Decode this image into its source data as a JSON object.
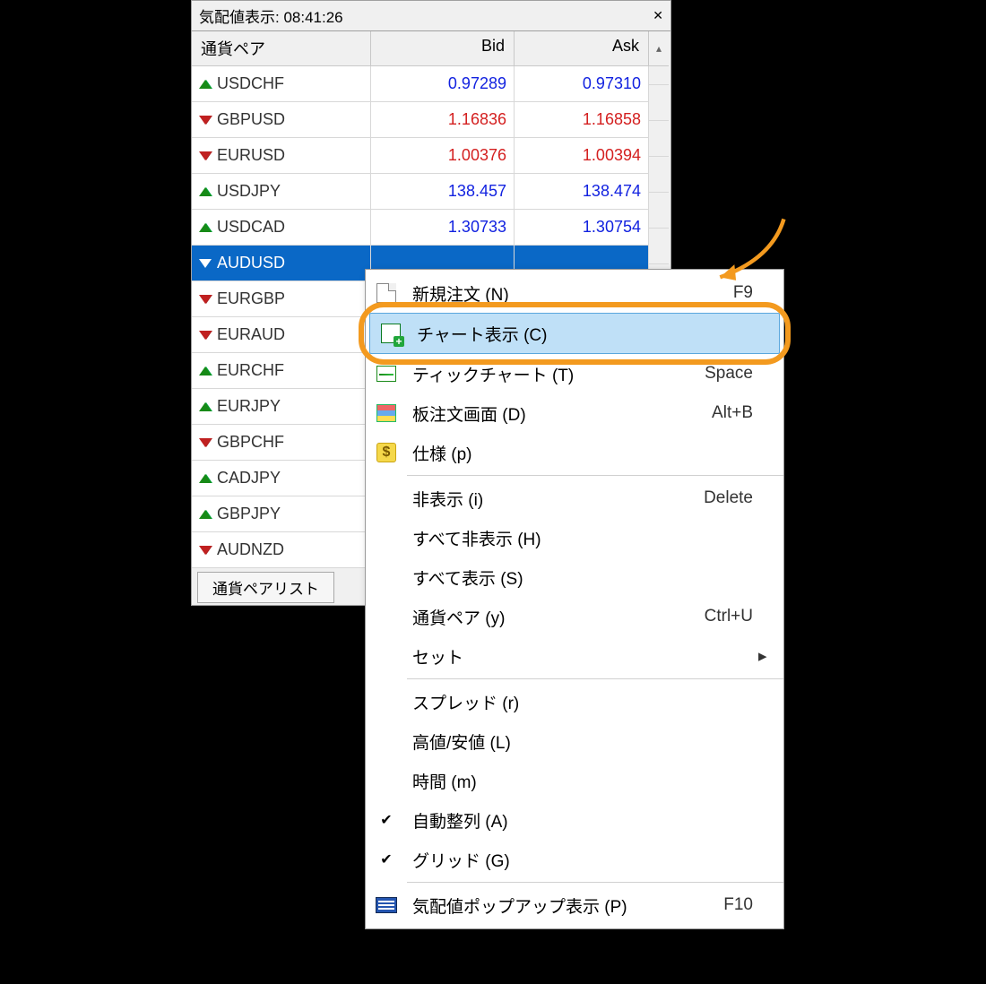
{
  "panel": {
    "title": "気配値表示: 08:41:26",
    "columns": {
      "symbol": "通貨ペア",
      "bid": "Bid",
      "ask": "Ask"
    },
    "tab": "通貨ペアリスト"
  },
  "rows": [
    {
      "dir": "up",
      "symbol": "USDCHF",
      "bid": "0.97289",
      "ask": "0.97310",
      "color": "blue"
    },
    {
      "dir": "down",
      "symbol": "GBPUSD",
      "bid": "1.16836",
      "ask": "1.16858",
      "color": "red"
    },
    {
      "dir": "down",
      "symbol": "EURUSD",
      "bid": "1.00376",
      "ask": "1.00394",
      "color": "red"
    },
    {
      "dir": "up",
      "symbol": "USDJPY",
      "bid": "138.457",
      "ask": "138.474",
      "color": "blue"
    },
    {
      "dir": "up",
      "symbol": "USDCAD",
      "bid": "1.30733",
      "ask": "1.30754",
      "color": "blue"
    },
    {
      "dir": "down",
      "symbol": "AUDUSD",
      "bid": "",
      "ask": "",
      "selected": true
    },
    {
      "dir": "down",
      "symbol": "EURGBP"
    },
    {
      "dir": "down",
      "symbol": "EURAUD"
    },
    {
      "dir": "up",
      "symbol": "EURCHF"
    },
    {
      "dir": "up",
      "symbol": "EURJPY"
    },
    {
      "dir": "down",
      "symbol": "GBPCHF"
    },
    {
      "dir": "up",
      "symbol": "CADJPY"
    },
    {
      "dir": "up",
      "symbol": "GBPJPY"
    },
    {
      "dir": "down",
      "symbol": "AUDNZD"
    }
  ],
  "menu": [
    {
      "icon": "doc",
      "label": "新規注文 (N)",
      "shortcut": "F9"
    },
    {
      "icon": "chart",
      "label": "チャート表示 (C)",
      "highlight": true
    },
    {
      "icon": "tick",
      "label": "ティックチャート (T)",
      "shortcut": "Space"
    },
    {
      "icon": "grid",
      "label": "板注文画面 (D)",
      "shortcut": "Alt+B"
    },
    {
      "icon": "dollar",
      "label": "仕様 (p)"
    },
    {
      "sep": true
    },
    {
      "label": "非表示 (i)",
      "shortcut": "Delete"
    },
    {
      "label": "すべて非表示 (H)"
    },
    {
      "label": "すべて表示 (S)"
    },
    {
      "label": "通貨ペア (y)",
      "shortcut": "Ctrl+U"
    },
    {
      "label": "セット",
      "submenu": true
    },
    {
      "sep": true
    },
    {
      "label": "スプレッド (r)"
    },
    {
      "label": "高値/安値 (L)"
    },
    {
      "label": "時間 (m)"
    },
    {
      "check": true,
      "label": "自動整列 (A)"
    },
    {
      "check": true,
      "label": "グリッド (G)"
    },
    {
      "sep": true
    },
    {
      "icon": "win",
      "label": "気配値ポップアップ表示 (P)",
      "shortcut": "F10"
    }
  ]
}
